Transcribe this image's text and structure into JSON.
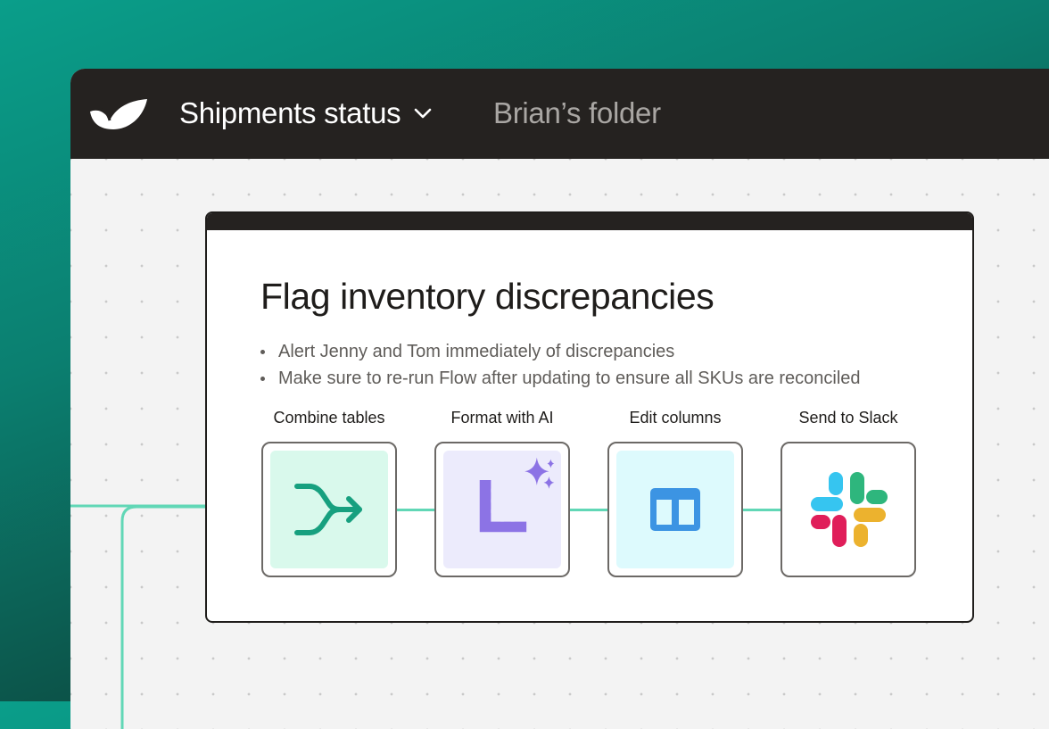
{
  "header": {
    "title": "Shipments status",
    "folder": "Brian’s folder"
  },
  "card": {
    "title": "Flag inventory discrepancies",
    "bullets": [
      "Alert Jenny and Tom immediately of discrepancies",
      "Make sure to re-run Flow after updating to ensure all SKUs are reconciled"
    ]
  },
  "steps": [
    {
      "label": "Combine tables",
      "icon": "merge-arrow-icon",
      "bg": "#d9f9ec"
    },
    {
      "label": "Format with AI",
      "icon": "ruler-sparkles-icon",
      "bg": "#ecebfc"
    },
    {
      "label": "Edit columns",
      "icon": "columns-icon",
      "bg": "#ddfafd"
    },
    {
      "label": "Send to Slack",
      "icon": "slack-icon",
      "bg": "#ffffff"
    }
  ],
  "colors": {
    "accent": "#61d7b6",
    "merge": "#17a07f",
    "ruler": "#8c73e5",
    "columns": "#3c94e3",
    "slack_blue": "#36c5f0",
    "slack_green": "#2eb67d",
    "slack_yellow": "#ecb22e",
    "slack_red": "#e01e5a",
    "titlebar": "#252220"
  }
}
